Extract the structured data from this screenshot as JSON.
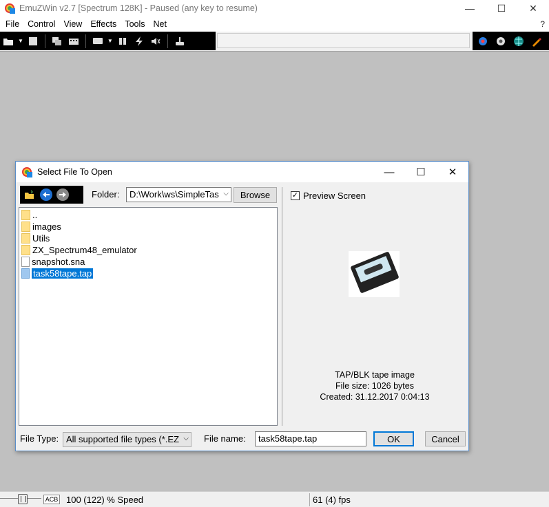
{
  "window": {
    "title": "EmuZWin v2.7 [Spectrum 128K] - Paused (any key to resume)",
    "minimize": "—",
    "maximize": "☐",
    "close": "✕"
  },
  "menu": {
    "items": [
      "File",
      "Control",
      "View",
      "Effects",
      "Tools",
      "Net"
    ],
    "help": "?"
  },
  "toolbar": {
    "icons": [
      "open-icon",
      "stop-icon",
      "copy-icon",
      "keyboard-icon",
      "monitor-icon",
      "pause-icon",
      "turbo-icon",
      "sound-icon",
      "joystick-icon"
    ],
    "right_icons": [
      "gear-blue-icon",
      "gear-white-icon",
      "globe-icon",
      "pen-icon"
    ]
  },
  "dialog": {
    "title": "Select File To Open",
    "folder_label": "Folder:",
    "folder_value": "D:\\Work\\ws\\SimpleTas",
    "browse_label": "Browse",
    "files": [
      {
        "name": "..",
        "type": "folder"
      },
      {
        "name": "images",
        "type": "folder"
      },
      {
        "name": "Utils",
        "type": "folder"
      },
      {
        "name": "ZX_Spectrum48_emulator",
        "type": "folder"
      },
      {
        "name": "snapshot.sna",
        "type": "file"
      },
      {
        "name": "task58tape.tap",
        "type": "tap",
        "selected": true
      }
    ],
    "preview_label": "Preview Screen",
    "preview_checked": true,
    "info": {
      "type": "TAP/BLK tape image",
      "size": "File size:  1026 bytes",
      "created": "Created: 31.12.2017 0:04:13"
    },
    "filetype_label": "File Type:",
    "filetype_value": "All supported file types (*.EZ",
    "filename_label": "File name:",
    "filename_value": "task58tape.tap",
    "ok_label": "OK",
    "cancel_label": "Cancel"
  },
  "status": {
    "acb": "ACB",
    "speed": "100 (122) % Speed",
    "fps": "61 (4) fps"
  },
  "colors": {
    "workspace": "#c0c0c0",
    "accent": "#0078d7",
    "toolbar_bg": "#000000"
  }
}
